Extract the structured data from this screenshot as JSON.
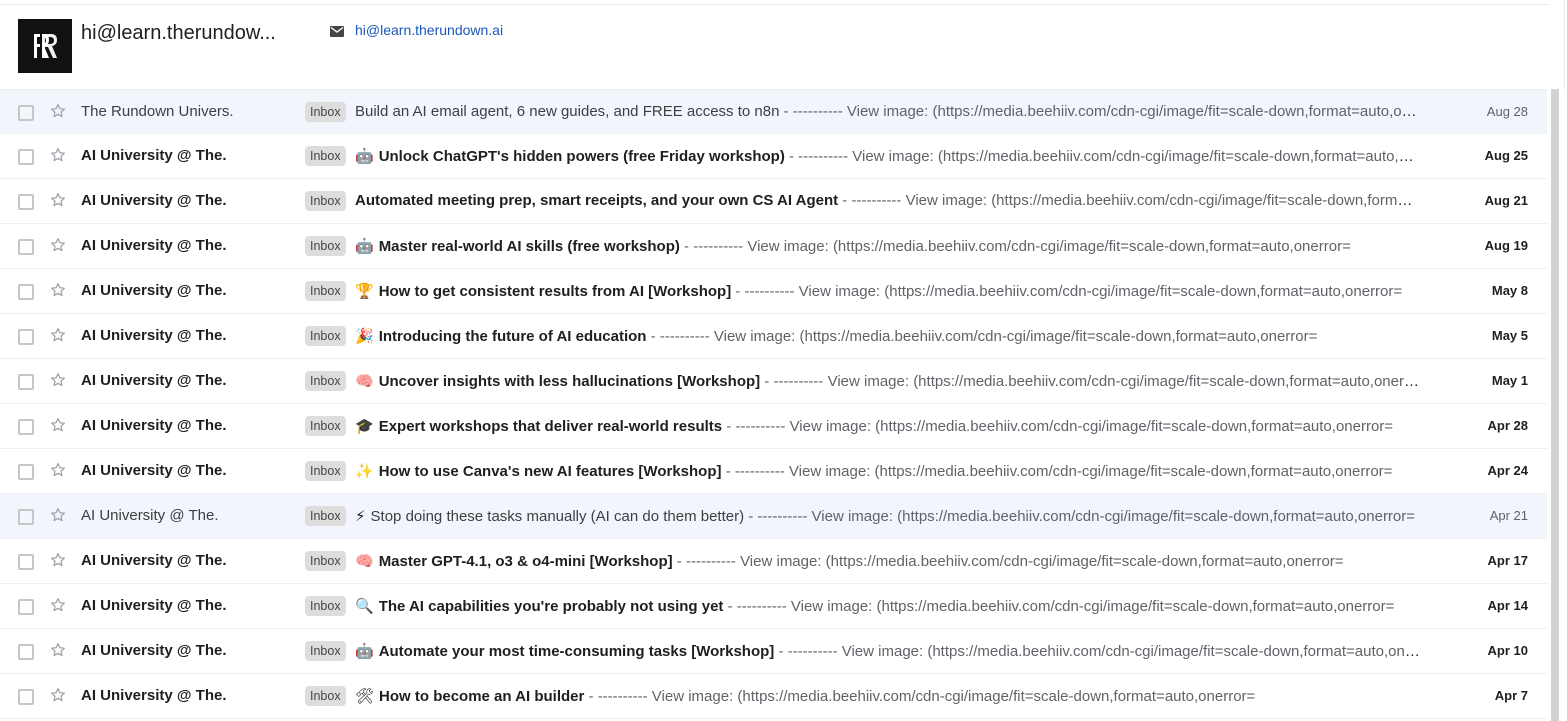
{
  "header": {
    "sender_name": "hi@learn.therundow...",
    "sender_email": "hi@learn.therundown.ai"
  },
  "icons": {
    "mail": "mail-icon",
    "star": "star-icon",
    "checkbox": "checkbox"
  },
  "colors": {
    "link": "#1a56b8",
    "read_row_bg": "#f2f6fc",
    "label_bg": "#dddddd"
  },
  "emails": [
    {
      "from": "The Rundown Univers.",
      "label": "Inbox",
      "emoji": "",
      "subject": "Build an AI email agent, 6 new guides, and FREE access to n8n",
      "snippet": " - ---------- View image: (https://media.beehiiv.com/cdn-cgi/image/fit=scale-down,format=auto,onerror=",
      "date": "Aug 28",
      "read": true
    },
    {
      "from": "AI University @ The.",
      "label": "Inbox",
      "emoji": "🤖",
      "subject": "Unlock ChatGPT's hidden powers (free Friday workshop)",
      "snippet": " - ---------- View image: (https://media.beehiiv.com/cdn-cgi/image/fit=scale-down,format=auto,onerror=",
      "date": "Aug 25",
      "read": false
    },
    {
      "from": "AI University @ The.",
      "label": "Inbox",
      "emoji": "",
      "subject": "Automated meeting prep, smart receipts, and your own CS AI Agent",
      "snippet": " - ---------- View image: (https://media.beehiiv.com/cdn-cgi/image/fit=scale-down,format=auto,onerror=",
      "date": "Aug 21",
      "read": false
    },
    {
      "from": "AI University @ The.",
      "label": "Inbox",
      "emoji": "🤖",
      "subject": "Master real-world AI skills (free workshop)",
      "snippet": " - ---------- View image: (https://media.beehiiv.com/cdn-cgi/image/fit=scale-down,format=auto,onerror=",
      "date": "Aug 19",
      "read": false
    },
    {
      "from": "AI University @ The.",
      "label": "Inbox",
      "emoji": "🏆",
      "subject": "How to get consistent results from AI [Workshop]",
      "snippet": " - ---------- View image: (https://media.beehiiv.com/cdn-cgi/image/fit=scale-down,format=auto,onerror=",
      "date": "May 8",
      "read": false
    },
    {
      "from": "AI University @ The.",
      "label": "Inbox",
      "emoji": "🎉",
      "subject": "Introducing the future of AI education",
      "snippet": " - ---------- View image: (https://media.beehiiv.com/cdn-cgi/image/fit=scale-down,format=auto,onerror=",
      "date": "May 5",
      "read": false
    },
    {
      "from": "AI University @ The.",
      "label": "Inbox",
      "emoji": "🧠",
      "subject": "Uncover insights with less hallucinations [Workshop]",
      "snippet": " - ---------- View image: (https://media.beehiiv.com/cdn-cgi/image/fit=scale-down,format=auto,onerror=",
      "date": "May 1",
      "read": false
    },
    {
      "from": "AI University @ The.",
      "label": "Inbox",
      "emoji": "🎓",
      "subject": "Expert workshops that deliver real-world results",
      "snippet": " - ---------- View image: (https://media.beehiiv.com/cdn-cgi/image/fit=scale-down,format=auto,onerror=",
      "date": "Apr 28",
      "read": false
    },
    {
      "from": "AI University @ The.",
      "label": "Inbox",
      "emoji": "✨",
      "subject": "How to use Canva's new AI features [Workshop]",
      "snippet": " - ---------- View image: (https://media.beehiiv.com/cdn-cgi/image/fit=scale-down,format=auto,onerror=",
      "date": "Apr 24",
      "read": false
    },
    {
      "from": "AI University @ The.",
      "label": "Inbox",
      "emoji": "⚡",
      "subject": "Stop doing these tasks manually (AI can do them better)",
      "snippet": " - ---------- View image: (https://media.beehiiv.com/cdn-cgi/image/fit=scale-down,format=auto,onerror=",
      "date": "Apr 21",
      "read": true
    },
    {
      "from": "AI University @ The.",
      "label": "Inbox",
      "emoji": "🧠",
      "subject": "Master GPT-4.1, o3 & o4-mini [Workshop]",
      "snippet": " - ---------- View image: (https://media.beehiiv.com/cdn-cgi/image/fit=scale-down,format=auto,onerror=",
      "date": "Apr 17",
      "read": false
    },
    {
      "from": "AI University @ The.",
      "label": "Inbox",
      "emoji": "🔍",
      "subject": "The AI capabilities you're probably not using yet",
      "snippet": " - ---------- View image: (https://media.beehiiv.com/cdn-cgi/image/fit=scale-down,format=auto,onerror=",
      "date": "Apr 14",
      "read": false
    },
    {
      "from": "AI University @ The.",
      "label": "Inbox",
      "emoji": "🤖",
      "subject": "Automate your most time-consuming tasks [Workshop]",
      "snippet": " - ---------- View image: (https://media.beehiiv.com/cdn-cgi/image/fit=scale-down,format=auto,onerror=",
      "date": "Apr 10",
      "read": false
    },
    {
      "from": "AI University @ The.",
      "label": "Inbox",
      "emoji": "🛠",
      "subject": "How to become an AI builder",
      "snippet": " - ---------- View image: (https://media.beehiiv.com/cdn-cgi/image/fit=scale-down,format=auto,onerror=",
      "date": "Apr 7",
      "read": false
    }
  ]
}
